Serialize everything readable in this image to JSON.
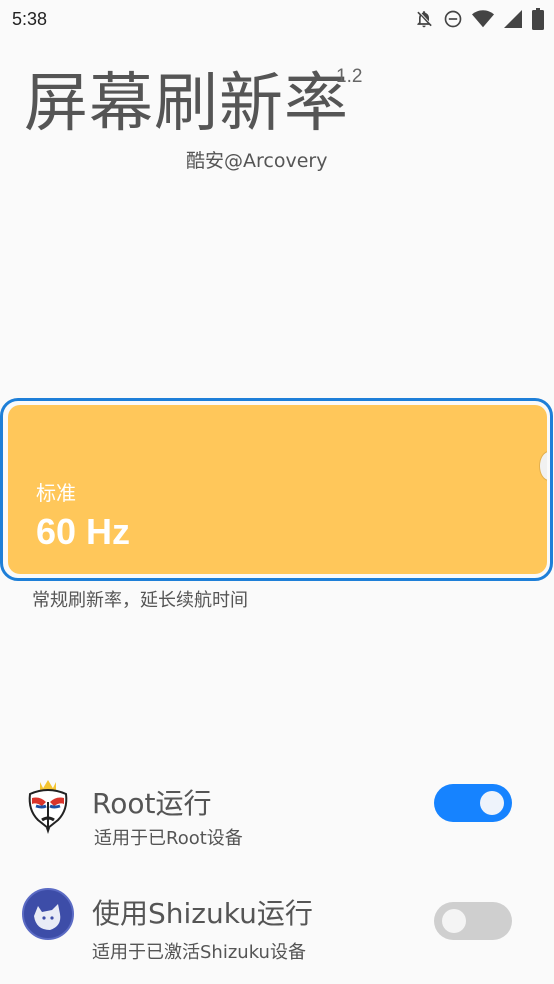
{
  "status_bar": {
    "time": "5:38",
    "icons": [
      "notifications-off-icon",
      "do-not-disturb-icon",
      "wifi-icon",
      "signal-icon",
      "battery-icon"
    ]
  },
  "header": {
    "title": "屏幕刷新率",
    "version": "1.2",
    "author": "酷安@Arcovery"
  },
  "mode_card": {
    "label": "标准",
    "value": "60 Hz",
    "description": "常规刷新率，延长续航时间",
    "color": "#ffc75a",
    "outline_color": "#1e7fd8"
  },
  "options": [
    {
      "title": "Root运行",
      "subtitle": "适用于已Root设备",
      "icon": "magisk-mask-icon",
      "enabled": true
    },
    {
      "title": "使用Shizuku运行",
      "subtitle": "适用于已激活Shizuku设备",
      "icon": "shizuku-icon",
      "enabled": false
    }
  ],
  "colors": {
    "toggle_on": "#1683ff",
    "toggle_off": "#cfcfcf"
  }
}
